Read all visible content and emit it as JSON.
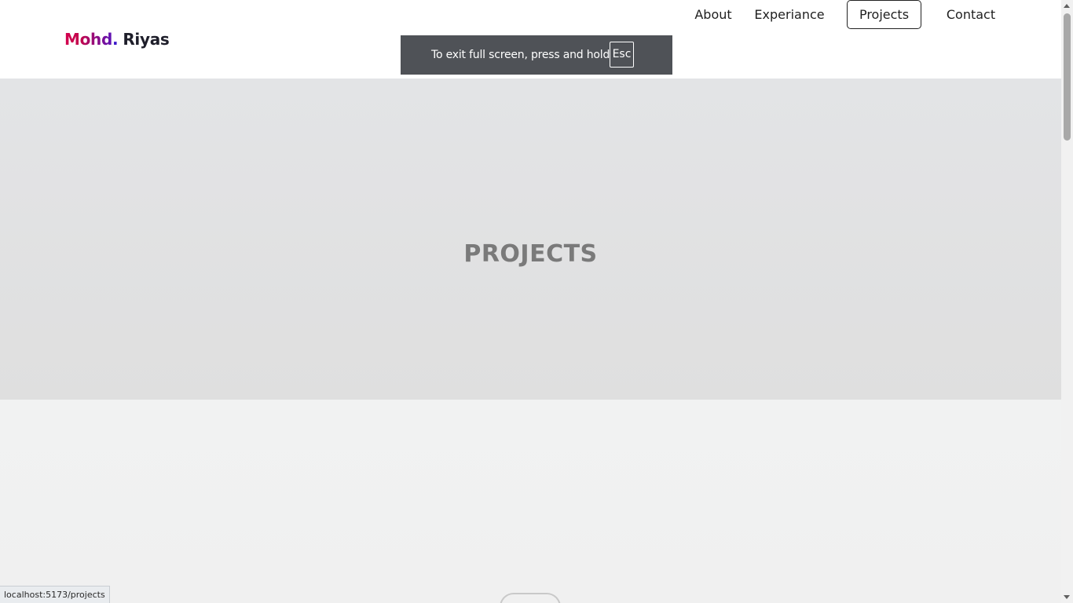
{
  "header": {
    "logo": {
      "first": "Mohd",
      "dot": ".",
      "last": "Riyas"
    },
    "nav": [
      {
        "label": "About"
      },
      {
        "label": "Experiance"
      },
      {
        "label": "Projects",
        "active": true
      },
      {
        "label": "Contact"
      }
    ]
  },
  "fullscreen_notice": {
    "message": "To exit full screen, press and hold",
    "key": "Esc"
  },
  "hero": {
    "title": "PROJECTS"
  },
  "status_bar": {
    "url": "localhost:5173/projects"
  },
  "colors": {
    "hero_bg": "#e1e2e3",
    "section_bg": "#f1f1f1",
    "toast_bg": "#4f5257",
    "logo_gradient_start": "#d4004e",
    "logo_gradient_end": "#5b12b8"
  }
}
